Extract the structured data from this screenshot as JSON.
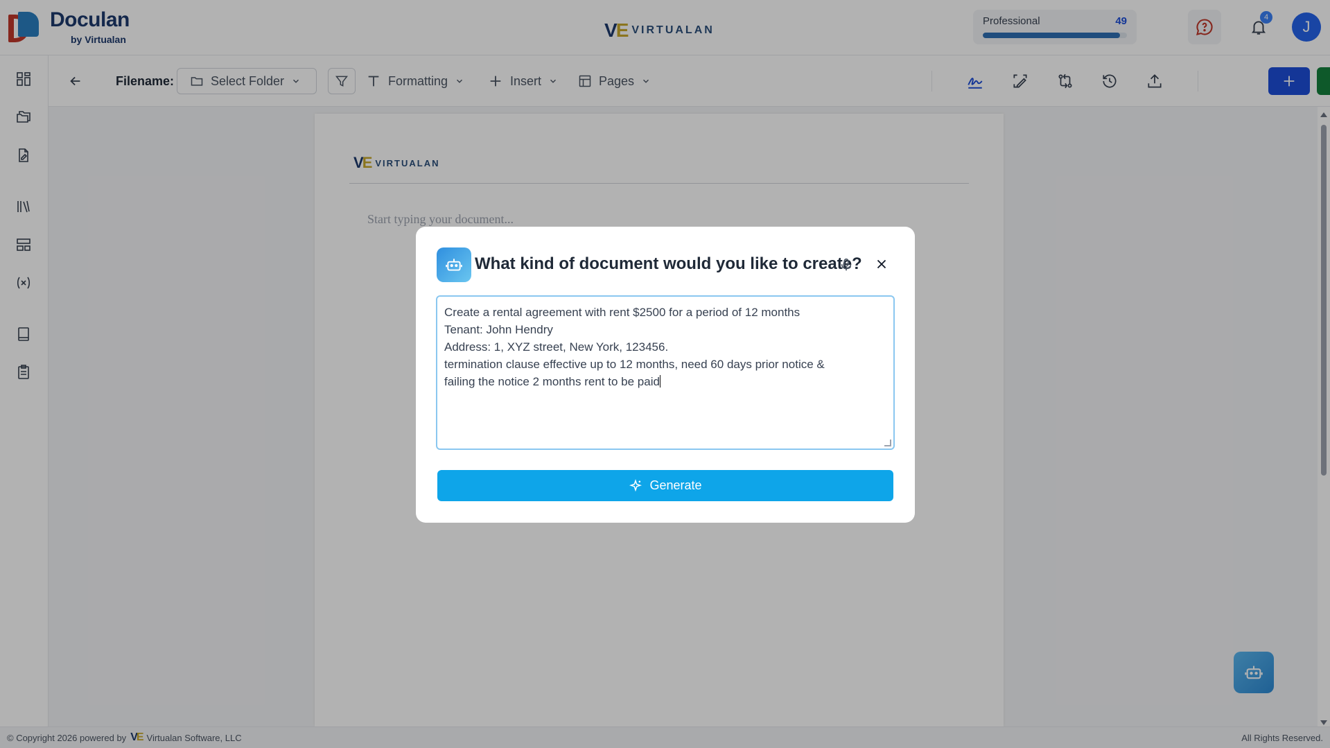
{
  "header": {
    "brand": "Doculan",
    "brand_sub": "by Virtualan",
    "center_logo": "VIRTUALAN",
    "plan": {
      "name": "Professional",
      "count": "49",
      "usage_fraction": 0.95
    },
    "notifications_count": "4",
    "avatar_initial": "J"
  },
  "toolbar": {
    "filename_label": "Filename:",
    "folder_select": "Select Folder",
    "formatting": "Formatting",
    "insert": "Insert",
    "pages": "Pages"
  },
  "document": {
    "logo": "VIRTUALAN",
    "placeholder": "Start typing your document..."
  },
  "modal": {
    "title": "What kind of document would you like to create?",
    "prompt_text": "Create a rental agreement with rent $2500 for a period of 12 months\nTenant: John Hendry\nAddress: 1, XYZ street, New York, 123456.\ntermination clause effective up to 12 months, need 60 days prior notice &\nfailing the notice 2 months rent to be paid",
    "generate_label": "Generate"
  },
  "footer": {
    "copyright": "© Copyright 2026 powered by",
    "company": "Virtualan Software, LLC",
    "rights": "All Rights Reserved."
  },
  "colors": {
    "primary_blue": "#1d4ed8",
    "save_green": "#15803d",
    "generate": "#0ea5e9",
    "brand_navy": "#1e3a6e"
  },
  "icons": [
    "dashboard-icon",
    "folders-icon",
    "document-edit-icon",
    "library-icon",
    "template-icon",
    "variable-icon",
    "book-icon",
    "clipboard-icon",
    "back-arrow-icon",
    "folder-icon",
    "chevron-down-icon",
    "filter-icon",
    "text-icon",
    "plus-icon",
    "layout-icon",
    "signature-icon",
    "scan-icon",
    "compare-icon",
    "history-icon",
    "upload-icon",
    "save-icon",
    "chat-help-icon",
    "bell-icon",
    "robot-icon",
    "microphone-icon",
    "close-icon",
    "sparkle-icon"
  ]
}
